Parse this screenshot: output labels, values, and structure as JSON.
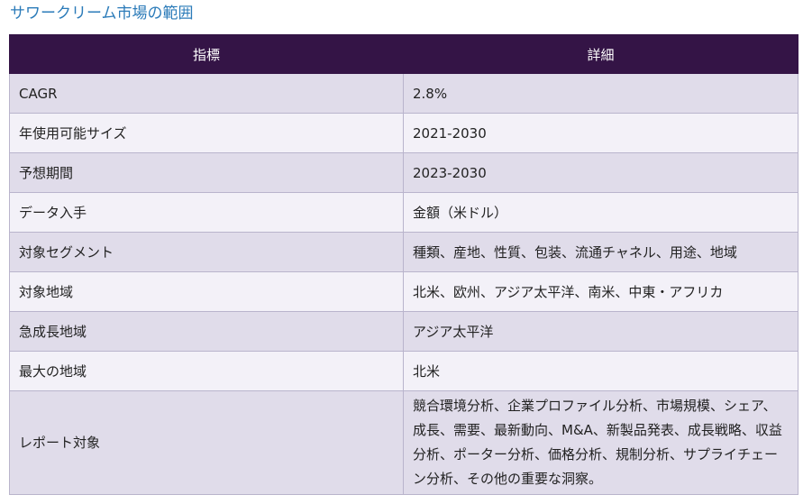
{
  "heading": "サワークリーム市場の範囲",
  "table": {
    "headers": [
      "指標",
      "詳細"
    ],
    "rows": [
      {
        "label": "CAGR",
        "value": "2.8%"
      },
      {
        "label": "年使用可能サイズ",
        "value": "2021-2030"
      },
      {
        "label": "予想期間",
        "value": "2023-2030"
      },
      {
        "label": "データ入手",
        "value": "金額（米ドル）"
      },
      {
        "label": "対象セグメント",
        "value": "種類、産地、性質、包装、流通チャネル、用途、地域"
      },
      {
        "label": "対象地域",
        "value": "北米、欧州、アジア太平洋、南米、中東・アフリカ"
      },
      {
        "label": "急成長地域",
        "value": "アジア太平洋"
      },
      {
        "label": "最大の地域",
        "value": "北米"
      },
      {
        "label": "レポート対象",
        "value": "競合環境分析、企業プロファイル分析、市場規模、シェア、成長、需要、最新動向、M&A、新製品発表、成長戦略、収益分析、ポーター分析、価格分析、規制分析、サプライチェーン分析、その他の重要な洞察。"
      }
    ]
  }
}
